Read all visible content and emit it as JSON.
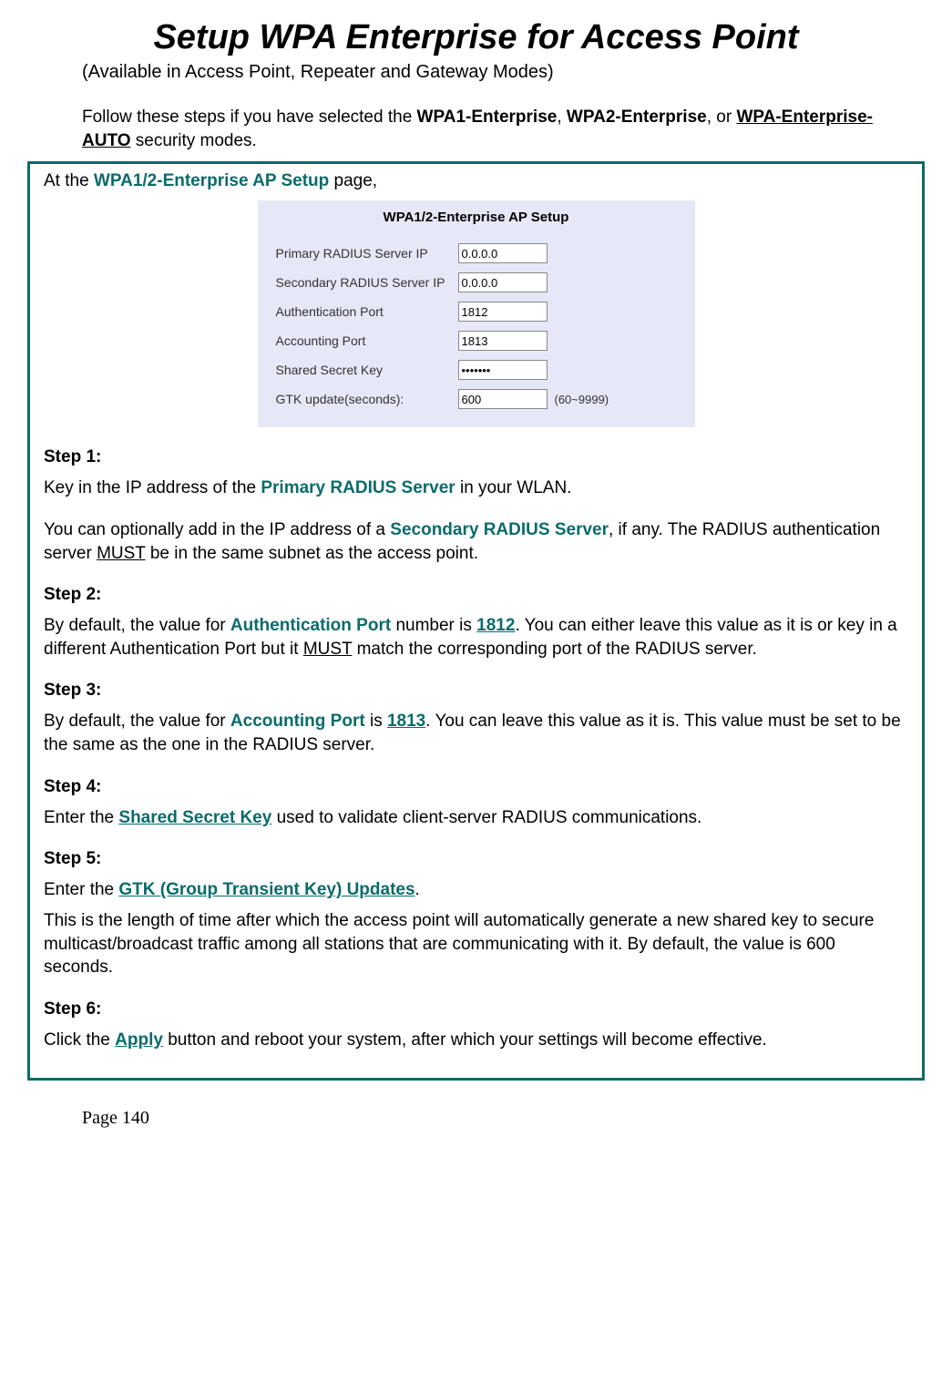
{
  "title": "Setup WPA Enterprise for Access Point",
  "subtitle": "(Available in Access Point, Repeater and Gateway Modes)",
  "intro_prefix": "Follow these steps if you have selected the ",
  "intro_mode1": "WPA1-Enterprise",
  "intro_sep1": ", ",
  "intro_mode2": "WPA2-Enterprise",
  "intro_sep2": ", or ",
  "intro_mode3": "WPA-Enterprise-AUTO",
  "intro_suffix": " security modes.",
  "at_prefix": "At the ",
  "at_page": "WPA1/2-Enterprise AP Setup",
  "at_suffix": " page,",
  "screenshot": {
    "title": "WPA1/2-Enterprise AP Setup",
    "rows": {
      "primary_label": "Primary RADIUS Server IP",
      "primary_value": "0.0.0.0",
      "secondary_label": "Secondary RADIUS Server IP",
      "secondary_value": "0.0.0.0",
      "auth_label": "Authentication Port",
      "auth_value": "1812",
      "acct_label": "Accounting Port",
      "acct_value": "1813",
      "secret_label": "Shared Secret Key",
      "secret_value": "•••••••",
      "gtk_label": "GTK update(seconds):",
      "gtk_value": "600",
      "gtk_range": "(60~9999)"
    }
  },
  "step1": {
    "label": "Step 1:",
    "p1_a": "Key in the IP address of the ",
    "p1_b": "Primary RADIUS Server",
    "p1_c": " in your WLAN.",
    "p2_a": "You can optionally add in the IP address of a ",
    "p2_b": "Secondary RADIUS Server",
    "p2_c": ", if any. The RADIUS authentication server ",
    "p2_d": "MUST",
    "p2_e": " be in the same subnet as the access point."
  },
  "step2": {
    "label": "Step 2:",
    "p1_a": "By default, the value for ",
    "p1_b": "Authentication Port",
    "p1_c": " number is ",
    "p1_d": "1812",
    "p1_e": ". You can either leave this value as it is or key in a different Authentication Port but it ",
    "p1_f": "MUST",
    "p1_g": " match the corresponding port of the RADIUS server."
  },
  "step3": {
    "label": "Step 3:",
    "p1_a": "By default, the value for ",
    "p1_b": "Accounting Port",
    "p1_c": " is ",
    "p1_d": "1813",
    "p1_e": ". You can leave this value as it is. This value must be set to be the same as the one in the RADIUS server."
  },
  "step4": {
    "label": "Step 4:",
    "p1_a": "Enter the ",
    "p1_b": "Shared Secret Key",
    "p1_c": " used to validate client-server RADIUS communications."
  },
  "step5": {
    "label": "Step 5:",
    "p1_a": "Enter the ",
    "p1_b": "GTK (Group Transient Key) Updates",
    "p1_c": ".",
    "p2": "This is the length of time after which the access point will automatically generate a new shared key to secure multicast/broadcast traffic among all stations that are communicating with it. By default, the value is 600 seconds."
  },
  "step6": {
    "label": "Step 6:",
    "p1_a": "Click the ",
    "p1_b": "Apply",
    "p1_c": " button and reboot your system, after which your settings will become effective."
  },
  "page_number": "Page 140"
}
